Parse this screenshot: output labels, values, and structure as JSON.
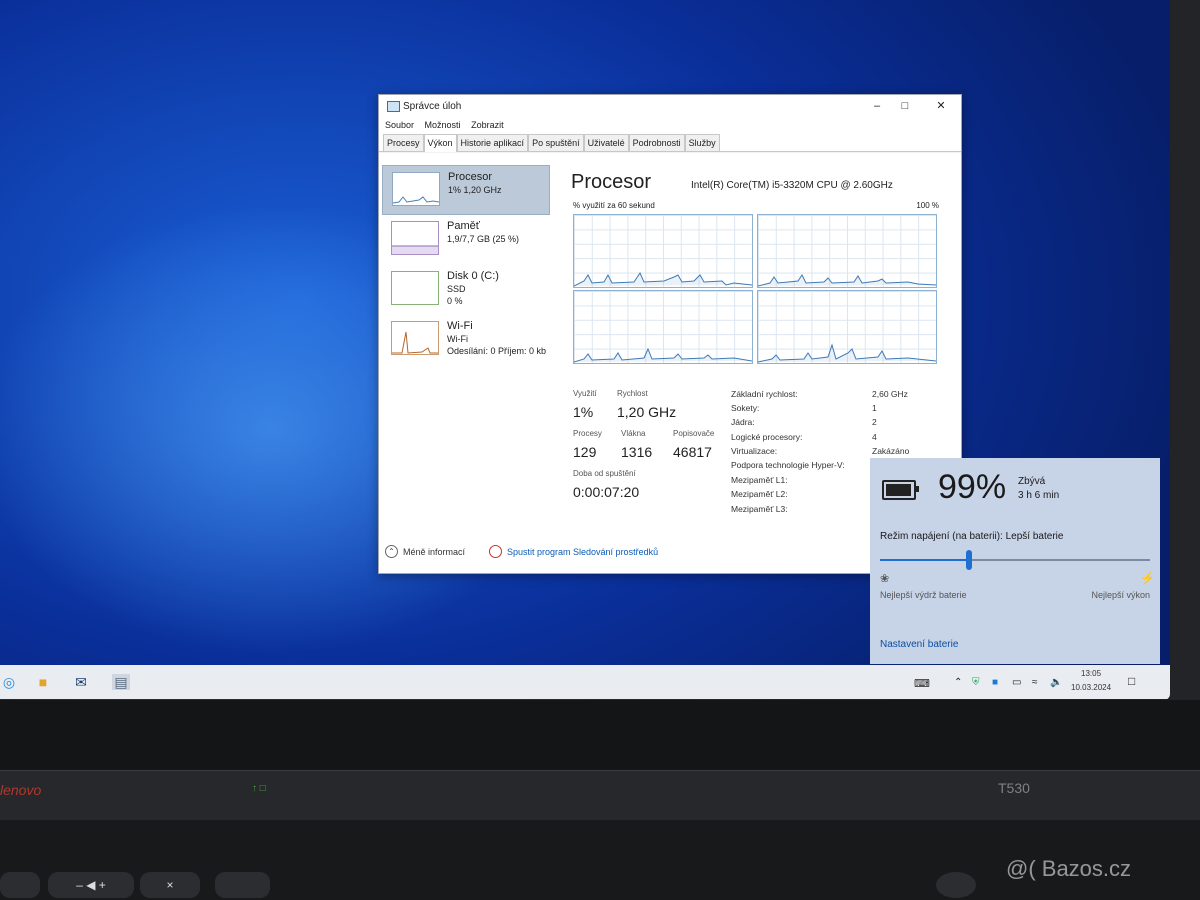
{
  "window": {
    "title": "Správce úloh",
    "menu": [
      "Soubor",
      "Možnosti",
      "Zobrazit"
    ],
    "tabs": [
      "Procesy",
      "Výkon",
      "Historie aplikací",
      "Po spuštění",
      "Uživatelé",
      "Podrobnosti",
      "Služby"
    ],
    "active_tab": "Výkon"
  },
  "sidebar": {
    "items": [
      {
        "name": "Procesor",
        "line1": "1% 1,20 GHz",
        "line2": ""
      },
      {
        "name": "Paměť",
        "line1": "1,9/7,7 GB (25 %)",
        "line2": ""
      },
      {
        "name": "Disk 0 (C:)",
        "line1": "SSD",
        "line2": "0 %"
      },
      {
        "name": "Wi-Fi",
        "line1": "Wi-Fi",
        "line2": "Odesílání: 0 Příjem: 0 kb"
      }
    ]
  },
  "main": {
    "title": "Procesor",
    "cpu_model": "Intel(R) Core(TM) i5-3320M CPU @ 2.60GHz",
    "graph_caption": "% využití za 60 sekund",
    "graph_max": "100 %",
    "stats": {
      "utilization_label": "Využití",
      "utilization": "1%",
      "speed_label": "Rychlost",
      "speed": "1,20 GHz",
      "processes_label": "Procesy",
      "processes": "129",
      "threads_label": "Vlákna",
      "threads": "1316",
      "handles_label": "Popisovače",
      "handles": "46817",
      "uptime_label": "Doba od spuštění",
      "uptime": "0:00:07:20"
    },
    "specs": [
      {
        "label": "Základní rychlost:",
        "value": "2,60 GHz"
      },
      {
        "label": "Sokety:",
        "value": "1"
      },
      {
        "label": "Jádra:",
        "value": "2"
      },
      {
        "label": "Logické procesory:",
        "value": "4"
      },
      {
        "label": "Virtualizace:",
        "value": "Zakázáno"
      },
      {
        "label": "Podpora technologie Hyper-V:",
        "value": ""
      },
      {
        "label": "Mezipaměť L1:",
        "value": ""
      },
      {
        "label": "Mezipaměť L2:",
        "value": ""
      },
      {
        "label": "Mezipaměť L3:",
        "value": ""
      }
    ]
  },
  "footer": {
    "fewer_details": "Méně informací",
    "resource_monitor": "Spustit program Sledování prostředků"
  },
  "battery": {
    "percent": "99%",
    "remaining_label": "Zbývá",
    "remaining": "3 h 6 min",
    "power_mode": "Režim napájení (na baterii): Lepší baterie",
    "slider_level": 0.33,
    "slider_left": "Nejlepší výdrž baterie",
    "slider_right": "Nejlepší výkon",
    "settings_link": "Nastavení baterie"
  },
  "taskbar": {
    "time": "13:05",
    "date": "10.03.2024"
  },
  "laptop": {
    "brand": "lenovo",
    "model": "T530"
  },
  "watermark": "@( Bazos.cz"
}
